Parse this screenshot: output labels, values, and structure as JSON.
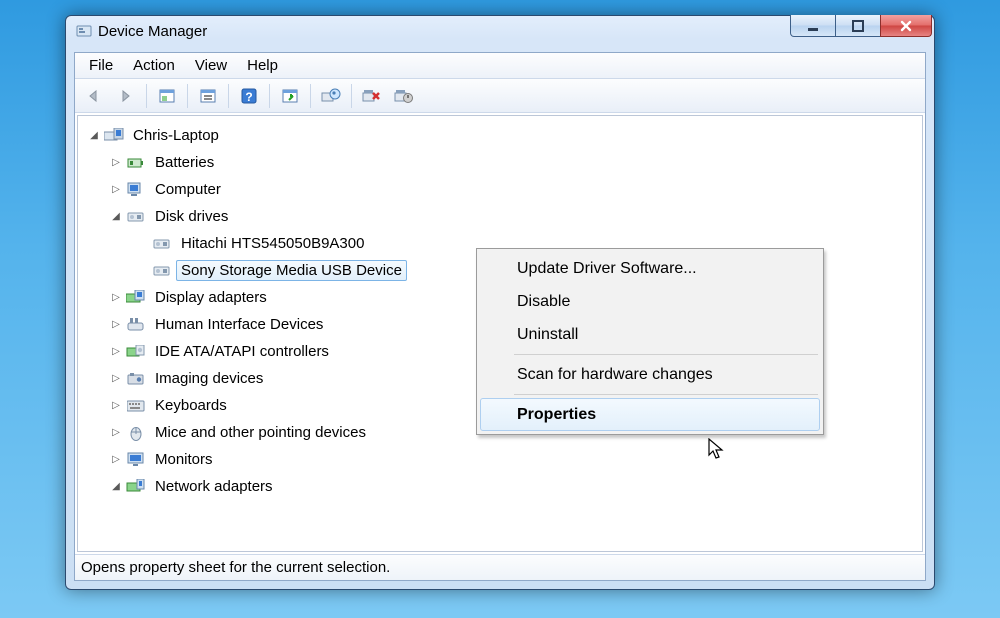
{
  "title": "Device Manager",
  "menu": {
    "file": "File",
    "action": "Action",
    "view": "View",
    "help": "Help"
  },
  "status": "Opens property sheet for the current selection.",
  "tree": {
    "root": {
      "label": "Chris-Laptop",
      "expander": "open"
    },
    "items": [
      {
        "label": "Batteries",
        "expander": "closed",
        "icon": "battery"
      },
      {
        "label": "Computer",
        "expander": "closed",
        "icon": "computer"
      },
      {
        "label": "Disk drives",
        "expander": "open",
        "icon": "disk",
        "children": [
          {
            "label": "Hitachi HTS545050B9A300",
            "icon": "disk"
          },
          {
            "label": "Sony Storage Media USB Device",
            "icon": "disk",
            "selected": true
          }
        ]
      },
      {
        "label": "Display adapters",
        "expander": "closed",
        "icon": "display"
      },
      {
        "label": "Human Interface Devices",
        "expander": "closed",
        "icon": "hid"
      },
      {
        "label": "IDE ATA/ATAPI controllers",
        "expander": "closed",
        "icon": "ide"
      },
      {
        "label": "Imaging devices",
        "expander": "closed",
        "icon": "imaging"
      },
      {
        "label": "Keyboards",
        "expander": "closed",
        "icon": "keyboard"
      },
      {
        "label": "Mice and other pointing devices",
        "expander": "closed",
        "icon": "mouse"
      },
      {
        "label": "Monitors",
        "expander": "closed",
        "icon": "monitor"
      },
      {
        "label": "Network adapters",
        "expander": "open",
        "icon": "network"
      }
    ]
  },
  "ctx": {
    "update": "Update Driver Software...",
    "disable": "Disable",
    "uninstall": "Uninstall",
    "scan": "Scan for hardware changes",
    "properties": "Properties"
  }
}
